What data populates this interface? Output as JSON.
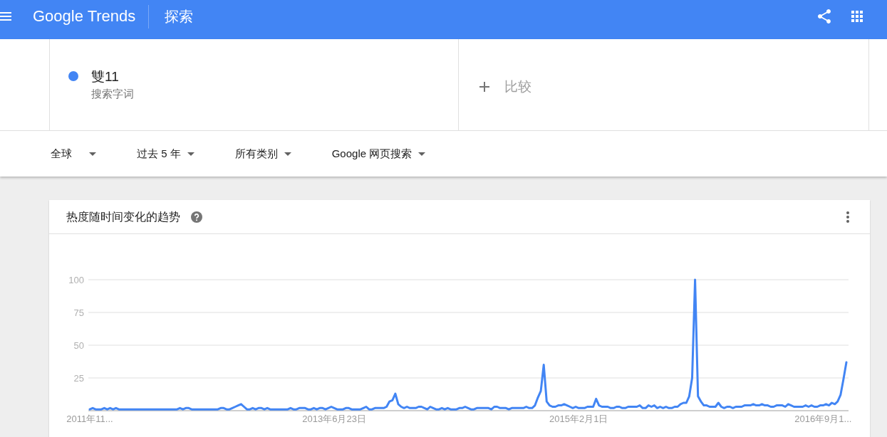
{
  "header": {
    "logo": "Google Trends",
    "page_title": "探索"
  },
  "search_terms": [
    {
      "term": "雙11",
      "subtitle": "搜索字词",
      "color": "#4285f4"
    }
  ],
  "compare": {
    "placeholder": "比较"
  },
  "filters": [
    {
      "label": "全球"
    },
    {
      "label": "过去 5 年"
    },
    {
      "label": "所有类别"
    },
    {
      "label": "Google 网页搜索"
    }
  ],
  "trend_card": {
    "title": "热度随时间变化的趋势",
    "chart_data": {
      "type": "line",
      "grid": true,
      "categories": [
        "2011年11...",
        null,
        null,
        null,
        null,
        null,
        null,
        null,
        null,
        null,
        null,
        null,
        null,
        null,
        null,
        null,
        null,
        null,
        null,
        null,
        null,
        null,
        null,
        null,
        null,
        null,
        null,
        null,
        null,
        null,
        null,
        null,
        null,
        null,
        null,
        null,
        null,
        null,
        null,
        null,
        null,
        null,
        null,
        null,
        null,
        null,
        null,
        null,
        null,
        null,
        null,
        null,
        null,
        null,
        null,
        null,
        null,
        null,
        null,
        null,
        null,
        null,
        null,
        null,
        null,
        null,
        null,
        null,
        null,
        null,
        null,
        null,
        null,
        null,
        null,
        null,
        null,
        null,
        null,
        null,
        null,
        null,
        null,
        null,
        "2013年6月23日",
        null,
        null,
        null,
        null,
        null,
        null,
        null,
        null,
        null,
        null,
        null,
        null,
        null,
        null,
        null,
        null,
        null,
        null,
        null,
        null,
        null,
        null,
        null,
        null,
        null,
        null,
        null,
        null,
        null,
        null,
        null,
        null,
        null,
        null,
        null,
        null,
        null,
        null,
        null,
        null,
        null,
        null,
        null,
        null,
        null,
        null,
        null,
        null,
        null,
        null,
        null,
        null,
        null,
        null,
        null,
        null,
        null,
        null,
        null,
        null,
        null,
        null,
        null,
        null,
        null,
        null,
        null,
        null,
        null,
        null,
        null,
        null,
        null,
        null,
        null,
        null,
        null,
        null,
        null,
        null,
        null,
        null,
        null,
        "2015年2月1日",
        null,
        null,
        null,
        null,
        null,
        null,
        null,
        null,
        null,
        null,
        null,
        null,
        null,
        null,
        null,
        null,
        null,
        null,
        null,
        null,
        null,
        null,
        null,
        null,
        null,
        null,
        null,
        null,
        null,
        null,
        null,
        null,
        null,
        null,
        null,
        null,
        null,
        null,
        null,
        null,
        null,
        null,
        null,
        null,
        null,
        null,
        null,
        null,
        null,
        null,
        null,
        null,
        null,
        null,
        null,
        null,
        null,
        null,
        null,
        null,
        null,
        null,
        null,
        null,
        null,
        null,
        null,
        null,
        null,
        null,
        null,
        null,
        null,
        null,
        null,
        null,
        null,
        null,
        null,
        null,
        null,
        null,
        null,
        "2016年9月1...",
        null,
        null,
        null,
        null,
        null,
        null,
        null,
        null
      ],
      "series": [
        {
          "color": "#4285f4",
          "values": [
            1,
            2,
            1,
            1,
            1,
            2,
            1,
            2,
            1,
            2,
            1,
            1,
            1,
            1,
            1,
            1,
            1,
            1,
            1,
            1,
            1,
            1,
            1,
            1,
            1,
            1,
            1,
            1,
            1,
            1,
            1,
            2,
            1,
            2,
            2,
            1,
            1,
            1,
            1,
            1,
            1,
            1,
            1,
            1,
            1,
            2,
            2,
            1,
            1,
            2,
            3,
            4,
            5,
            3,
            1,
            1,
            2,
            1,
            2,
            2,
            1,
            2,
            1,
            1,
            1,
            1,
            1,
            1,
            1,
            2,
            1,
            1,
            2,
            2,
            2,
            1,
            1,
            2,
            1,
            2,
            2,
            1,
            2,
            3,
            2,
            1,
            1,
            1,
            2,
            2,
            1,
            1,
            1,
            1,
            2,
            3,
            1,
            1,
            2,
            2,
            2,
            2,
            3,
            7,
            8,
            13,
            5,
            3,
            2,
            3,
            2,
            2,
            2,
            3,
            3,
            2,
            1,
            3,
            2,
            1,
            1,
            2,
            1,
            2,
            1,
            1,
            1,
            2,
            2,
            3,
            2,
            1,
            1,
            2,
            2,
            2,
            2,
            2,
            1,
            3,
            3,
            2,
            2,
            2,
            1,
            2,
            2,
            2,
            2,
            2,
            3,
            2,
            2,
            4,
            10,
            15,
            35,
            7,
            4,
            3,
            3,
            4,
            4,
            5,
            4,
            3,
            2,
            3,
            2,
            2,
            2,
            3,
            3,
            3,
            9,
            4,
            3,
            3,
            3,
            2,
            2,
            3,
            3,
            2,
            2,
            3,
            3,
            3,
            3,
            4,
            2,
            2,
            4,
            3,
            4,
            2,
            3,
            2,
            3,
            2,
            2,
            3,
            3,
            5,
            6,
            6,
            11,
            25,
            100,
            11,
            7,
            4,
            4,
            3,
            3,
            3,
            6,
            3,
            2,
            3,
            3,
            2,
            3,
            3,
            3,
            4,
            4,
            4,
            5,
            4,
            4,
            5,
            4,
            4,
            3,
            3,
            4,
            4,
            4,
            3,
            5,
            4,
            3,
            3,
            3,
            3,
            4,
            3,
            4,
            3,
            3,
            4,
            4,
            5,
            4,
            6,
            5,
            7,
            12,
            24,
            37
          ]
        }
      ],
      "ylim": [
        0,
        100
      ],
      "yticks": [
        25,
        50,
        75,
        100
      ]
    }
  }
}
